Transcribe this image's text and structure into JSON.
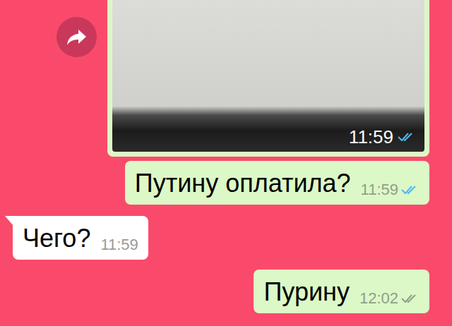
{
  "messages": [
    {
      "kind": "image",
      "direction": "out",
      "time": "11:59",
      "read": true
    },
    {
      "kind": "text",
      "direction": "out",
      "text": "Путину оплатила?",
      "time": "11:59",
      "read": true
    },
    {
      "kind": "text",
      "direction": "in",
      "text": "Чего?",
      "time": "11:59"
    },
    {
      "kind": "text",
      "direction": "out",
      "text": "Пурину",
      "time": "12:02",
      "read": false
    }
  ]
}
